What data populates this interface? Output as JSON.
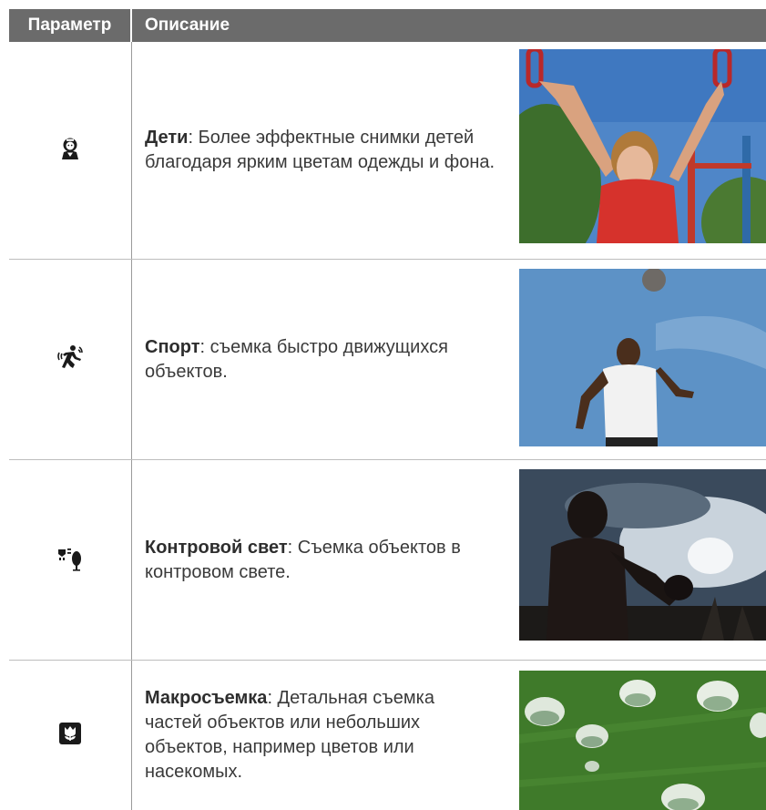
{
  "header": {
    "col_param": "Параметр",
    "col_desc": "Описание"
  },
  "rows": [
    {
      "icon": "child-icon",
      "title": "Дети",
      "text": ": Более эффектные снимки детей благодаря ярким цветам одежды и фона."
    },
    {
      "icon": "sport-icon",
      "title": "Спорт",
      "text": ": съемка быстро движущихся объектов."
    },
    {
      "icon": "backlight-icon",
      "title": "Контровой свет",
      "text": ": Съемка объектов в контровом свете."
    },
    {
      "icon": "macro-icon",
      "title": "Макросъемка",
      "text": ": Детальная съемка частей объектов или небольших объектов, например цветов или насекомых."
    }
  ],
  "colors": {
    "header_bg": "#6b6b6b",
    "text": "#3a3a3a"
  }
}
